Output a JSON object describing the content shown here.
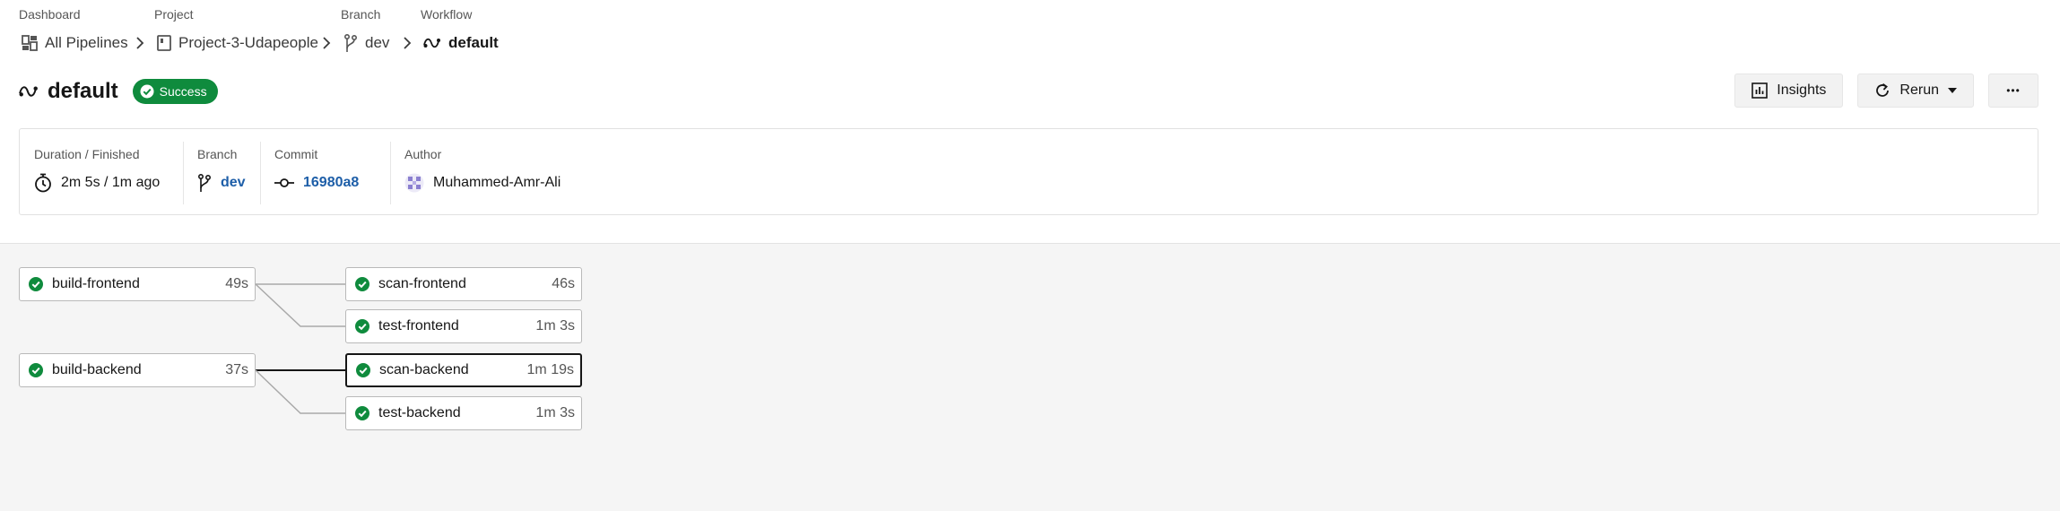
{
  "breadcrumb": {
    "labels": [
      "Dashboard",
      "Project",
      "Branch",
      "Workflow"
    ],
    "dashboard": "All Pipelines",
    "project": "Project-3-Udapeople",
    "branch": "dev",
    "workflow": "default"
  },
  "header": {
    "title": "default",
    "status": "Success",
    "insights_label": "Insights",
    "rerun_label": "Rerun",
    "more_label": "•••"
  },
  "info": {
    "duration_label": "Duration / Finished",
    "duration_value": "2m 5s / 1m ago",
    "branch_label": "Branch",
    "branch_value": "dev",
    "commit_label": "Commit",
    "commit_value": "16980a8",
    "author_label": "Author",
    "author_value": "Muhammed-Amr-Ali"
  },
  "jobs": [
    {
      "name": "build-frontend",
      "duration": "49s"
    },
    {
      "name": "scan-frontend",
      "duration": "46s"
    },
    {
      "name": "test-frontend",
      "duration": "1m 3s"
    },
    {
      "name": "build-backend",
      "duration": "37s"
    },
    {
      "name": "scan-backend",
      "duration": "1m 19s",
      "selected": true
    },
    {
      "name": "test-backend",
      "duration": "1m 3s"
    }
  ],
  "colors": {
    "success": "#0f8b3d",
    "link": "#1d5ea8",
    "canvas": "#f5f5f5"
  },
  "icons": {
    "dashboard": "dashboard-grid-icon",
    "project": "project-book-icon",
    "branch": "git-branch-icon",
    "workflow": "workflow-icon",
    "status": "check-circle-icon",
    "insights": "bar-chart-icon",
    "rerun": "refresh-icon",
    "duration": "stopwatch-icon",
    "commit": "git-commit-icon",
    "author": "avatar-icon"
  }
}
